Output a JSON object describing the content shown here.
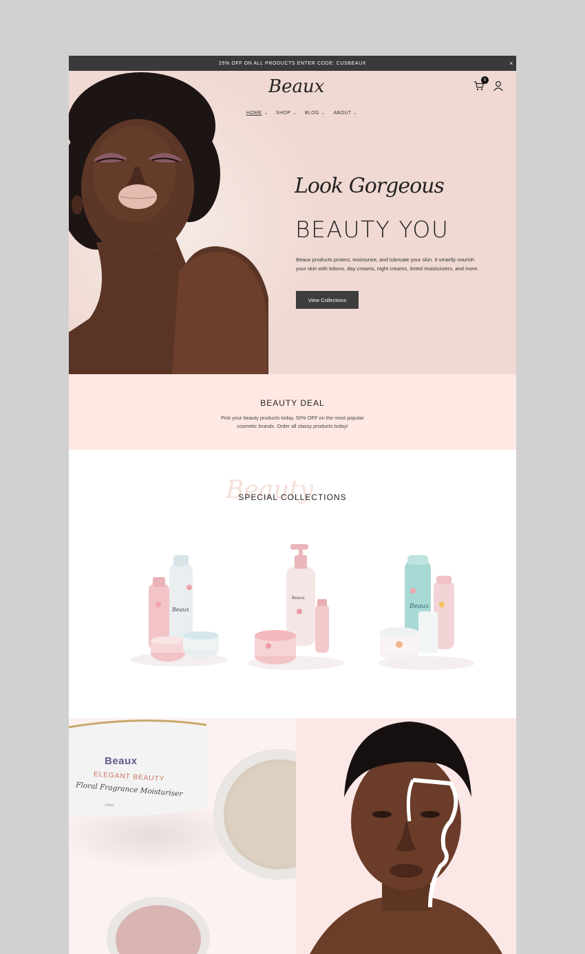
{
  "announcement": {
    "text": "25% OFF ON ALL PRODUCTS ENTER CODE: CUSBEAUX",
    "close": "×"
  },
  "header": {
    "logo": "Beaux",
    "nav": [
      {
        "label": "HOME",
        "active": true
      },
      {
        "label": "SHOP",
        "active": false
      },
      {
        "label": "BLOG",
        "active": false
      },
      {
        "label": "ABOUT",
        "active": false
      }
    ],
    "cart_count": "0",
    "icons": [
      "cart-icon",
      "user-icon"
    ]
  },
  "hero": {
    "script": "Look Gorgeous",
    "title": "BEAUTY YOU",
    "text": "Beaux products protect, moisturize, and lubricate your skin. It smartly nourish your skin with lotions, day creams, night creams, tinted moisturizers, and more.",
    "button": "View Collections"
  },
  "deal": {
    "title": "BEAUTY DEAL",
    "text": "Pick your beauty products today. 50% OFF on the most popular cosmetic brands. Order all classy products today!"
  },
  "collections": {
    "script": "Beauty",
    "title": "SPECIAL COLLECTIONS",
    "products": [
      {
        "brand": "Beaux"
      },
      {
        "brand": "Beaux"
      },
      {
        "brand": "Beaux"
      }
    ]
  },
  "showcase": {
    "jar_brand": "Beaux",
    "jar_line1": "ELEGANT BEAUTY",
    "jar_line2": "Floral Fragrance Moisturiser",
    "jar_size": "100ml"
  },
  "colors": {
    "announce_bg": "#3a3a3a",
    "hero_bg": "#f0d9d3",
    "deal_bg": "#fde8e3",
    "button_bg": "#3d3d3d",
    "outer_bg": "#d1d1d1"
  }
}
